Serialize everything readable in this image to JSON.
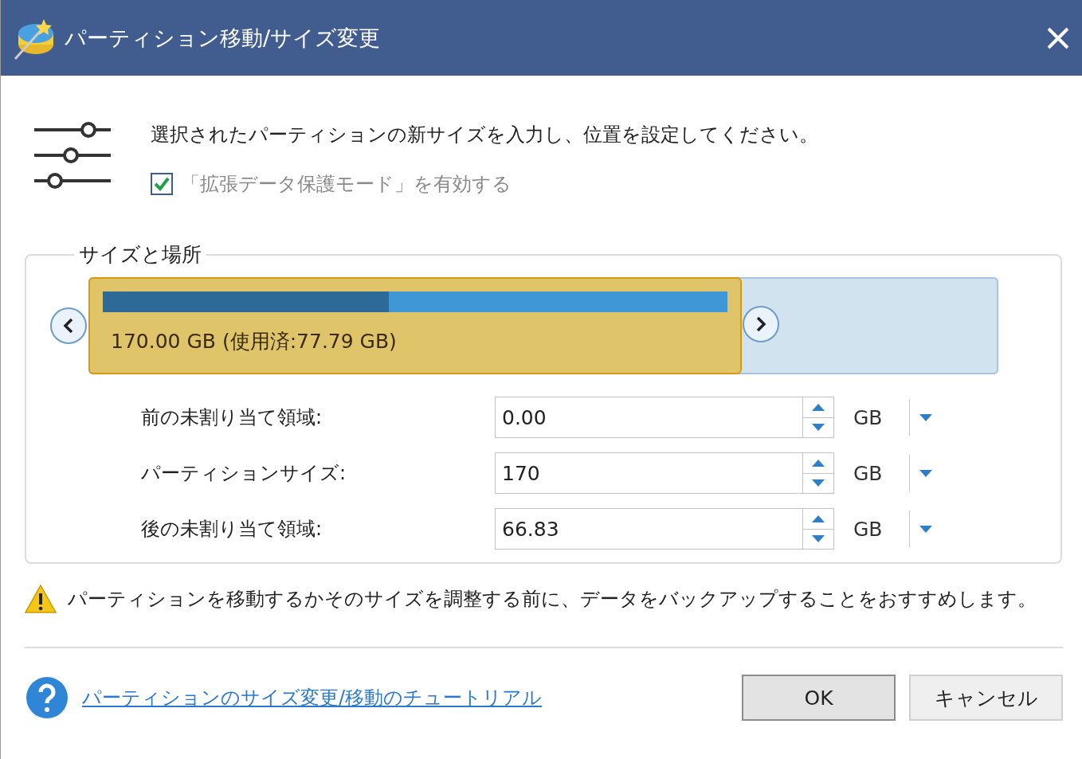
{
  "window": {
    "title": "パーティション移動/サイズ変更"
  },
  "instructions": "選択されたパーティションの新サイズを入力し、位置を設定してください。",
  "protect_mode": {
    "label": "「拡張データ保護モード」を有効する",
    "checked": true
  },
  "group": {
    "legend": "サイズと場所"
  },
  "partition": {
    "label": "170.00 GB (使用済:77.79 GB)",
    "level": 0.718,
    "used": {
      "level": 0.458
    }
  },
  "fields": [
    {
      "label": "前の未割り当て領域:",
      "value": "0.00",
      "unit": "GB"
    },
    {
      "label": "パーティションサイズ:",
      "value": "170",
      "unit": "GB"
    },
    {
      "label": "後の未割り当て領域:",
      "value": "66.83",
      "unit": "GB"
    }
  ],
  "warning": "パーティションを移動するかそのサイズを調整する前に、データをバックアップすることをおすすめします。",
  "help_link": "パーティションのサイズ変更/移動のチュートリアル",
  "buttons": [
    {
      "label": "OK",
      "default": true
    },
    {
      "label": "キャンセル",
      "default": false
    }
  ]
}
